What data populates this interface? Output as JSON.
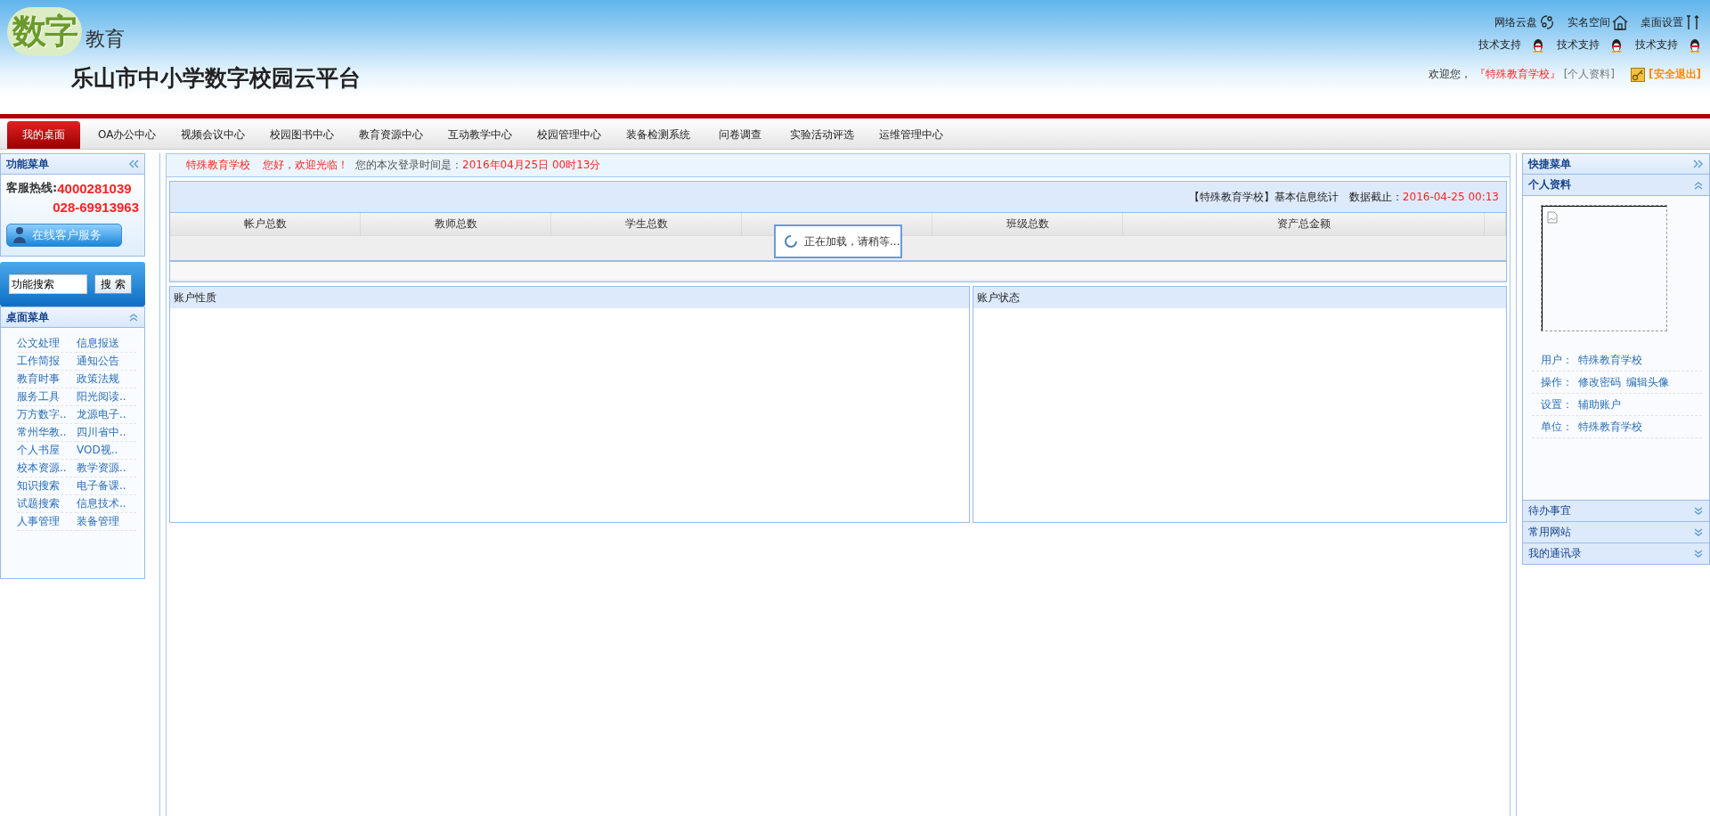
{
  "logo": {
    "mark": "数字",
    "text": "教育"
  },
  "site_title": "乐山市中小学数字校园云平台",
  "top_links": [
    {
      "label": "网络云盘",
      "kind": "cloud"
    },
    {
      "label": "实名空间",
      "kind": "house"
    },
    {
      "label": "桌面设置",
      "kind": "tools"
    }
  ],
  "support_links": [
    "技术支持",
    "技术支持",
    "技术支持"
  ],
  "user_bar": {
    "greeting": "欢迎您，",
    "school": "『特殊教育学校』",
    "profile": "[个人资料]",
    "logout": "[安全退出]"
  },
  "nav_tabs": [
    {
      "label": "我的桌面",
      "selected": true
    },
    {
      "label": "OA办公中心",
      "selected": false
    },
    {
      "label": "视频会议中心",
      "selected": false
    },
    {
      "label": "校园图书中心",
      "selected": false
    },
    {
      "label": "教育资源中心",
      "selected": false
    },
    {
      "label": "互动教学中心",
      "selected": false
    },
    {
      "label": "校园管理中心",
      "selected": false
    },
    {
      "label": "装备检测系统",
      "selected": false
    },
    {
      "label": "问卷调查",
      "selected": false
    },
    {
      "label": "实验活动评选",
      "selected": false
    },
    {
      "label": "运维管理中心",
      "selected": false
    }
  ],
  "left_sidebar": {
    "title": "功能菜单",
    "hotline_label": "客服热线:",
    "hotline_numbers": [
      "4000281039",
      "028-69913963"
    ],
    "service_button": "在线客户服务",
    "search_value": "功能搜索",
    "search_button": "搜 索",
    "desk_menu_title": "桌面菜单",
    "desk_menu": [
      "公文处理",
      "信息报送",
      "工作简报",
      "通知公告",
      "教育时事",
      "政策法规",
      "服务工具",
      "阳光阅读..",
      "万方数字..",
      "龙源电子..",
      "常州华教..",
      "四川省中..",
      "个人书屋",
      "VOD视..",
      "校本资源..",
      "教学资源..",
      "知识搜索",
      "电子备课..",
      "试题搜索",
      "信息技术..",
      "人事管理",
      "装备管理"
    ]
  },
  "welcome": {
    "school": "特殊教育学校",
    "hello": "您好，欢迎光临！",
    "login_label": "您的本次登录时间是：",
    "login_time": "2016年04月25日 00时13分"
  },
  "stats": {
    "title": "【特殊教育学校】基本信息统计",
    "as_of_label": "数据截止：",
    "as_of": "2016-04-25 00:13",
    "columns": [
      {
        "label": "帐户总数"
      },
      {
        "label": "教师总数"
      },
      {
        "label": "学生总数"
      },
      {},
      {
        "label": "班级总数"
      },
      {
        "label": "资产总金额"
      }
    ],
    "loading": "正在加载，请稍等..."
  },
  "panels": [
    "账户性质",
    "账户状态"
  ],
  "right_sidebar": {
    "title": "快捷菜单",
    "profile_title": "个人资料",
    "info": [
      {
        "label": "用户：",
        "links": [
          "特殊教育学校"
        ]
      },
      {
        "label": "操作：",
        "links": [
          "修改密码",
          "编辑头像"
        ]
      },
      {
        "label": "设置：",
        "links": [
          "辅助账户"
        ]
      },
      {
        "label": "单位：",
        "links": [
          "特殊教育学校"
        ]
      }
    ],
    "sections": [
      "待办事宜",
      "常用网站",
      "我的通讯录"
    ]
  }
}
